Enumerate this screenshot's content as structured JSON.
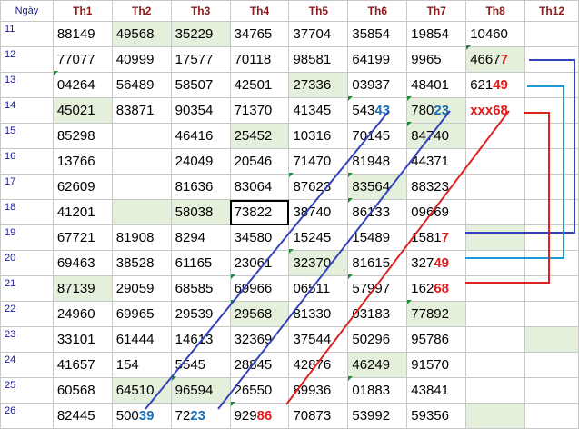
{
  "headers": [
    "Ngày",
    "Th1",
    "Th2",
    "Th3",
    "Th4",
    "Th5",
    "Th6",
    "Th7",
    "Th8",
    "Th12"
  ],
  "rows": [
    {
      "day": "11",
      "cells": [
        "88149",
        "49568",
        "35229",
        "34765",
        "37704",
        "35854",
        "19854",
        "10460",
        ""
      ]
    },
    {
      "day": "12",
      "cells": [
        "77077",
        "40999",
        "17577",
        "70118",
        "98581",
        "64199",
        "9965",
        "46677",
        ""
      ]
    },
    {
      "day": "13",
      "cells": [
        "04264",
        "56489",
        "58507",
        "42501",
        "27336",
        "03937",
        "48401",
        "62149",
        ""
      ]
    },
    {
      "day": "14",
      "cells": [
        "45021",
        "83871",
        "90354",
        "71370",
        "41345",
        "54343",
        "78023",
        "xxx68",
        ""
      ]
    },
    {
      "day": "15",
      "cells": [
        "85298",
        "",
        "46416",
        "25452",
        "10316",
        "70145",
        "84740",
        "",
        ""
      ]
    },
    {
      "day": "16",
      "cells": [
        "13766",
        "",
        "24049",
        "20546",
        "71470",
        "81948",
        "44371",
        "",
        ""
      ]
    },
    {
      "day": "17",
      "cells": [
        "62609",
        "",
        "81636",
        "83064",
        "87623",
        "83564",
        "88323",
        "",
        ""
      ]
    },
    {
      "day": "18",
      "cells": [
        "41201",
        "",
        "58038",
        "73822",
        "38740",
        "86133",
        "09669",
        "",
        ""
      ]
    },
    {
      "day": "19",
      "cells": [
        "67721",
        "81908",
        "8294",
        "34580",
        "15245",
        "15489",
        "15817",
        "",
        ""
      ]
    },
    {
      "day": "20",
      "cells": [
        "69463",
        "38528",
        "61165",
        "23061",
        "32370",
        "81615",
        "32749",
        "",
        ""
      ]
    },
    {
      "day": "21",
      "cells": [
        "87139",
        "29059",
        "68585",
        "69966",
        "06511",
        "57997",
        "16268",
        "",
        ""
      ]
    },
    {
      "day": "22",
      "cells": [
        "24960",
        "69965",
        "29539",
        "29568",
        "81330",
        "03183",
        "77892",
        "",
        ""
      ]
    },
    {
      "day": "23",
      "cells": [
        "33101",
        "61444",
        "14613",
        "32369",
        "37544",
        "50296",
        "95786",
        "",
        ""
      ]
    },
    {
      "day": "24",
      "cells": [
        "41657",
        "154",
        "5545",
        "28845",
        "42876",
        "46249",
        "91570",
        "",
        ""
      ]
    },
    {
      "day": "25",
      "cells": [
        "60568",
        "64510",
        "96594",
        "26550",
        "89936",
        "01883",
        "43841",
        "",
        ""
      ]
    },
    {
      "day": "26",
      "cells": [
        "82445",
        "50039",
        "7223",
        "92986",
        "70873",
        "53992",
        "59356",
        "",
        ""
      ]
    }
  ],
  "highlights": [
    {
      "row": 1,
      "col": 7,
      "prefix": "4667",
      "suffix": "7",
      "color": "#e01b1b"
    },
    {
      "row": 2,
      "col": 7,
      "prefix": "621",
      "suffix": "49",
      "color": "#e01b1b"
    },
    {
      "row": 3,
      "col": 5,
      "prefix": "543",
      "suffix": "43",
      "color": "#1a6fb5"
    },
    {
      "row": 3,
      "col": 6,
      "prefix": "780",
      "suffix": "23",
      "color": "#1a6fb5"
    },
    {
      "row": 3,
      "col": 7,
      "prefix": "xxx",
      "suffix": "68",
      "color": "#e01b1b"
    },
    {
      "row": 8,
      "col": 6,
      "prefix": "1581",
      "suffix": "7",
      "color": "#e01b1b"
    },
    {
      "row": 9,
      "col": 6,
      "prefix": "327",
      "suffix": "49",
      "color": "#e01b1b"
    },
    {
      "row": 10,
      "col": 6,
      "prefix": "162",
      "suffix": "68",
      "color": "#e01b1b"
    },
    {
      "row": 15,
      "col": 1,
      "prefix": "500",
      "suffix": "39",
      "color": "#1a6fb5"
    },
    {
      "row": 15,
      "col": 2,
      "prefix": "72",
      "suffix": "23",
      "color": "#1a6fb5"
    },
    {
      "row": 15,
      "col": 3,
      "prefix": "929",
      "suffix": "86",
      "color": "#e01b1b"
    }
  ],
  "green_cells": [
    [
      0,
      1
    ],
    [
      0,
      2
    ],
    [
      1,
      7
    ],
    [
      2,
      4
    ],
    [
      3,
      0
    ],
    [
      3,
      6
    ],
    [
      4,
      3
    ],
    [
      4,
      6
    ],
    [
      6,
      5
    ],
    [
      7,
      1
    ],
    [
      7,
      2
    ],
    [
      8,
      7
    ],
    [
      9,
      4
    ],
    [
      10,
      0
    ],
    [
      11,
      3
    ],
    [
      11,
      6
    ],
    [
      12,
      8
    ],
    [
      13,
      5
    ],
    [
      14,
      1
    ],
    [
      14,
      2
    ],
    [
      15,
      7
    ]
  ],
  "marked_cells": [
    [
      1,
      7
    ],
    [
      2,
      0
    ],
    [
      3,
      5
    ],
    [
      3,
      6
    ],
    [
      4,
      6
    ],
    [
      6,
      4
    ],
    [
      6,
      5
    ],
    [
      7,
      5
    ],
    [
      9,
      4
    ],
    [
      10,
      3
    ],
    [
      10,
      5
    ],
    [
      11,
      3
    ],
    [
      11,
      6
    ],
    [
      14,
      2
    ],
    [
      14,
      5
    ],
    [
      15,
      3
    ]
  ],
  "selected_cell": [
    7,
    3
  ],
  "colors": {
    "header_text": "#8b1a1a",
    "day_text": "#1a1a9c",
    "green_fill": "#e4f0dc",
    "line_blue": "#3344bb",
    "line_red": "#dd2222",
    "line_cyan": "#1a9ad9"
  }
}
